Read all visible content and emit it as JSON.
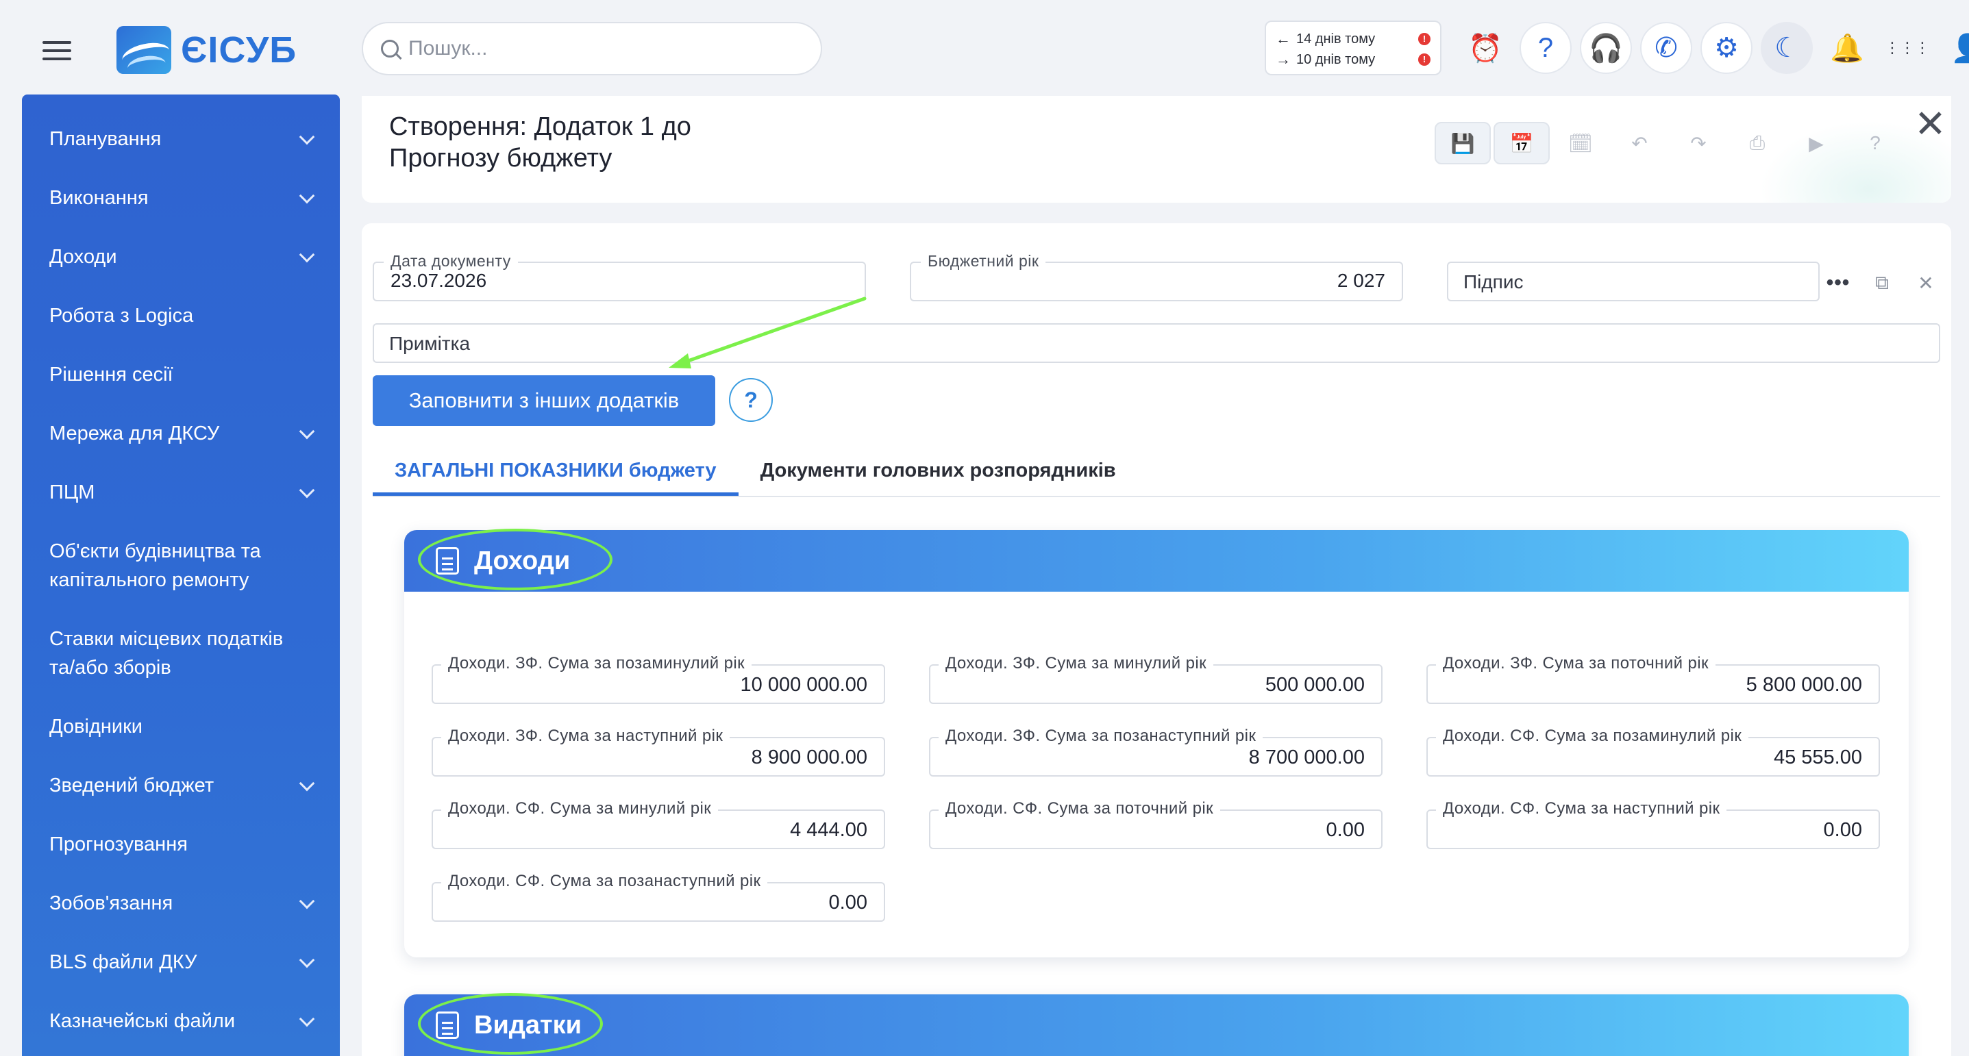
{
  "app": {
    "logo_text": "ЄІСУБ"
  },
  "search": {
    "placeholder": "Пошук..."
  },
  "history": [
    {
      "arrow": "←",
      "text": "14 днів тому",
      "badge": "!"
    },
    {
      "arrow": "→",
      "text": "10 днів тому",
      "badge": "!"
    }
  ],
  "top_icons": [
    {
      "name": "alarm-clock-icon",
      "glyph": "⏰"
    },
    {
      "name": "help-icon",
      "glyph": "?"
    },
    {
      "name": "headset-icon",
      "glyph": "🎧"
    },
    {
      "name": "phone-icon",
      "glyph": "✆"
    },
    {
      "name": "settings-gear-icon",
      "glyph": "⚙"
    },
    {
      "name": "dark-mode-moon-icon",
      "glyph": "☾"
    },
    {
      "name": "notifications-bell-icon",
      "glyph": "🔔"
    },
    {
      "name": "apps-grid-icon",
      "glyph": "⋮⋮⋮"
    },
    {
      "name": "user-account-icon",
      "glyph": "👤"
    }
  ],
  "sidebar": {
    "items": [
      {
        "label": "Планування",
        "chevron": true
      },
      {
        "label": "Виконання",
        "chevron": true
      },
      {
        "label": "Доходи",
        "chevron": true
      },
      {
        "label": "Робота з Logica",
        "chevron": false
      },
      {
        "label": "Рішення сесії",
        "chevron": false
      },
      {
        "label": "Мережа для ДКСУ",
        "chevron": true
      },
      {
        "label": "ПЦМ",
        "chevron": true
      },
      {
        "label": "Об'єкти будівництва та\nкапітального ремонту",
        "chevron": false
      },
      {
        "label": "Ставки місцевих податків\nта/або зборів",
        "chevron": false
      },
      {
        "label": "Довідники",
        "chevron": false
      },
      {
        "label": "Зведений бюджет",
        "chevron": true
      },
      {
        "label": "Прогнозування",
        "chevron": false
      },
      {
        "label": "Зобов'язання",
        "chevron": true
      },
      {
        "label": "BLS файли ДКУ",
        "chevron": true
      },
      {
        "label": "Казначейські файли",
        "chevron": true
      }
    ]
  },
  "header": {
    "title": "Створення: Додаток 1 до\nПрогнозу бюджету",
    "toolbar": [
      {
        "name": "save-icon",
        "glyph": "💾",
        "active": true,
        "style": "save"
      },
      {
        "name": "save-and-close-calendar-icon",
        "glyph": "📅",
        "active": true,
        "style": "cal"
      },
      {
        "name": "calendar-check-icon",
        "glyph": "🗓",
        "active": false,
        "style": ""
      },
      {
        "name": "undo-icon",
        "glyph": "↶",
        "active": false,
        "style": ""
      },
      {
        "name": "redo-icon",
        "glyph": "↷",
        "active": false,
        "style": ""
      },
      {
        "name": "print-icon",
        "glyph": "⎙",
        "active": false,
        "style": ""
      },
      {
        "name": "video-icon",
        "glyph": "▶",
        "active": false,
        "style": ""
      },
      {
        "name": "help-icon",
        "glyph": "?",
        "active": false,
        "style": ""
      }
    ],
    "close_glyph": "✕"
  },
  "form": {
    "doc_date": {
      "label": "Дата документу",
      "value": "23.07.2026"
    },
    "budget_year": {
      "label": "Бюджетний рік",
      "value": "2 027"
    },
    "signature": {
      "placeholder": "Підпис"
    },
    "note": {
      "placeholder": "Примітка"
    },
    "fill_button": "Заповнити з інших додатків",
    "help_glyph": "?"
  },
  "tabs": [
    {
      "label": "ЗАГАЛЬНІ ПОКАЗНИКИ бюджету",
      "active": true
    },
    {
      "label": "Документи головних розпорядників",
      "active": false
    }
  ],
  "income": {
    "title": "Доходи",
    "fields": [
      {
        "label": "Доходи. ЗФ. Сума за позаминулий рік",
        "value": "10 000 000.00"
      },
      {
        "label": "Доходи. ЗФ. Сума за минулий рік",
        "value": "500 000.00"
      },
      {
        "label": "Доходи. ЗФ. Сума за поточний рік",
        "value": "5 800 000.00"
      },
      {
        "label": "Доходи. ЗФ. Сума за наступний рік",
        "value": "8 900 000.00"
      },
      {
        "label": "Доходи. ЗФ. Сума за позанаступний рік",
        "value": "8 700 000.00"
      },
      {
        "label": "Доходи. СФ. Сума за позаминулий рік",
        "value": "45 555.00"
      },
      {
        "label": "Доходи. СФ. Сума за минулий рік",
        "value": "4 444.00"
      },
      {
        "label": "Доходи. СФ. Сума за поточний рік",
        "value": "0.00"
      },
      {
        "label": "Доходи. СФ. Сума за наступний рік",
        "value": "0.00"
      },
      {
        "label": "Доходи. СФ. Сума за позанаступний рік",
        "value": "0.00"
      }
    ]
  },
  "expenses": {
    "title": "Видатки"
  },
  "colors": {
    "accent": "#2f6fd8",
    "highlight": "#7cf04a",
    "sidebar": "#2f63d0"
  }
}
